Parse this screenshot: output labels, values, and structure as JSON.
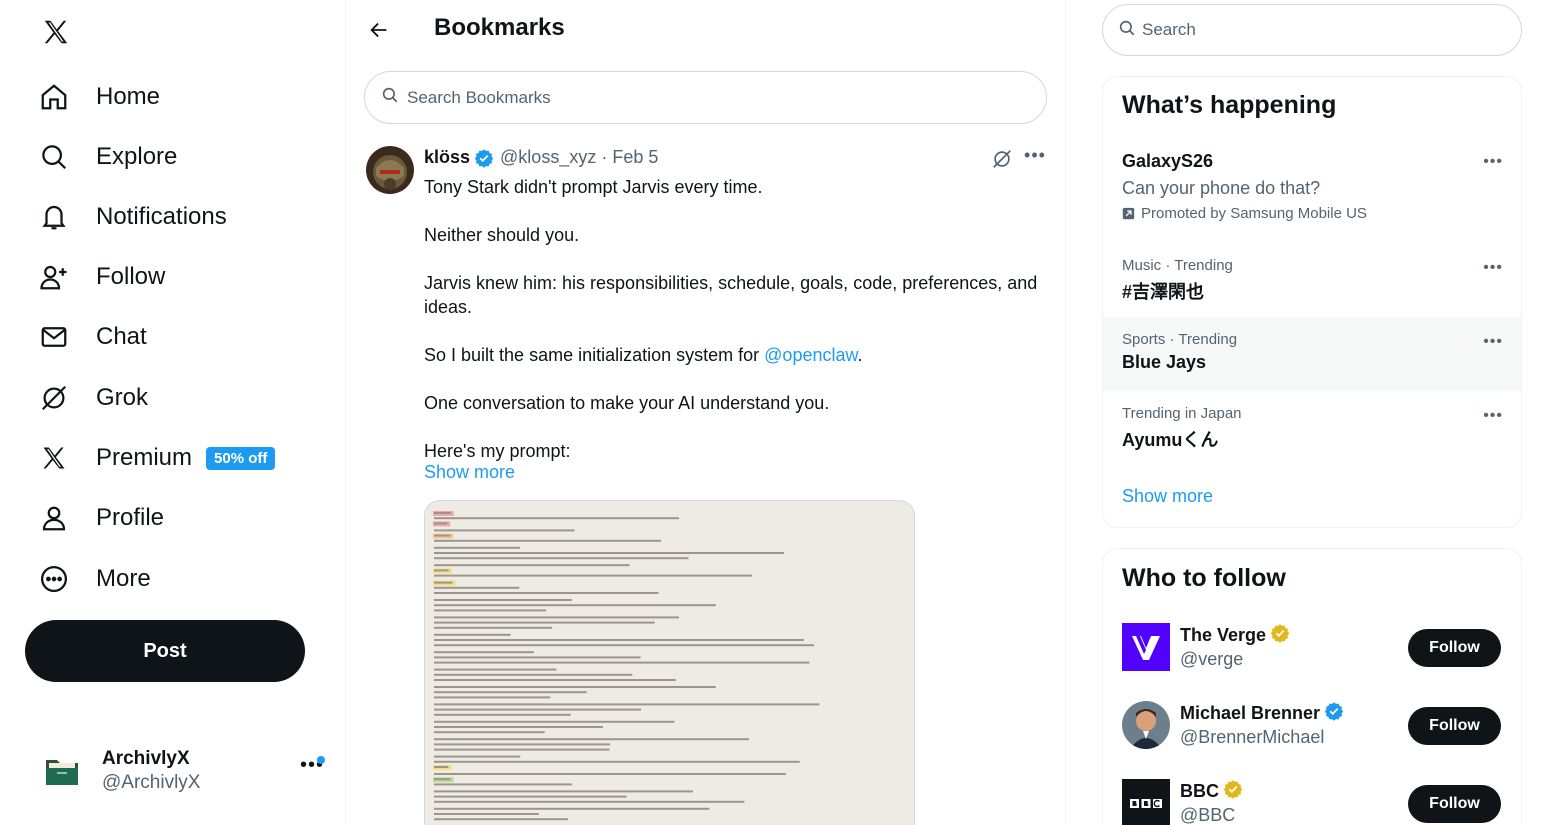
{
  "nav": {
    "items": [
      {
        "label": "Home",
        "icon": "home-icon"
      },
      {
        "label": "Explore",
        "icon": "search-icon"
      },
      {
        "label": "Notifications",
        "icon": "bell-icon"
      },
      {
        "label": "Follow",
        "icon": "follow-icon"
      },
      {
        "label": "Chat",
        "icon": "mail-icon"
      },
      {
        "label": "Grok",
        "icon": "grok-icon"
      },
      {
        "label": "Premium",
        "icon": "x-premium-icon",
        "badge": "50% off"
      },
      {
        "label": "Profile",
        "icon": "person-icon"
      },
      {
        "label": "More",
        "icon": "more-circle-icon"
      }
    ],
    "post_label": "Post"
  },
  "account": {
    "name": "ArchivlyX",
    "handle": "@ArchivlyX"
  },
  "header": {
    "title": "Bookmarks"
  },
  "bookmark_search": {
    "placeholder": "Search Bookmarks"
  },
  "tweet": {
    "author": "klöss",
    "handle": "@kloss_xyz",
    "separator": "·",
    "date": "Feb 5",
    "paragraphs": [
      "Tony Stark didn't prompt Jarvis every time.",
      "Neither should you.",
      "Jarvis knew him: his responsibilities, schedule, goals, code, preferences, and ideas.",
      "So I built the same initialization system for ",
      "One conversation to make your AI understand you.",
      "Here's my prompt:"
    ],
    "mention": "@openclaw",
    "mention_suffix": ".",
    "show_more": "Show more"
  },
  "search": {
    "placeholder": "Search"
  },
  "whats_happening": {
    "title": "What’s happening",
    "trends": [
      {
        "meta": "",
        "name": "GalaxyS26",
        "desc": "Can your phone do that?",
        "promo": "Promoted by Samsung Mobile US"
      },
      {
        "meta": "Music · Trending",
        "name": "#吉澤閑也"
      },
      {
        "meta": "Sports · Trending",
        "name": "Blue Jays"
      },
      {
        "meta": "Trending in Japan",
        "name": "Ayumuくん"
      }
    ],
    "show_more": "Show more"
  },
  "who_to_follow": {
    "title": "Who to follow",
    "accounts": [
      {
        "name": "The Verge",
        "handle": "@verge",
        "badge": "gold",
        "follow": "Follow"
      },
      {
        "name": "Michael Brenner",
        "handle": "@BrennerMichael",
        "badge": "blue",
        "follow": "Follow"
      },
      {
        "name": "BBC",
        "handle": "@BBC",
        "badge": "gold",
        "follow": "Follow"
      }
    ]
  },
  "colors": {
    "accent": "#1d9bf0",
    "text": "#0f1419",
    "muted": "#536471",
    "border": "#eff3f4",
    "gold": "#e2b719"
  }
}
